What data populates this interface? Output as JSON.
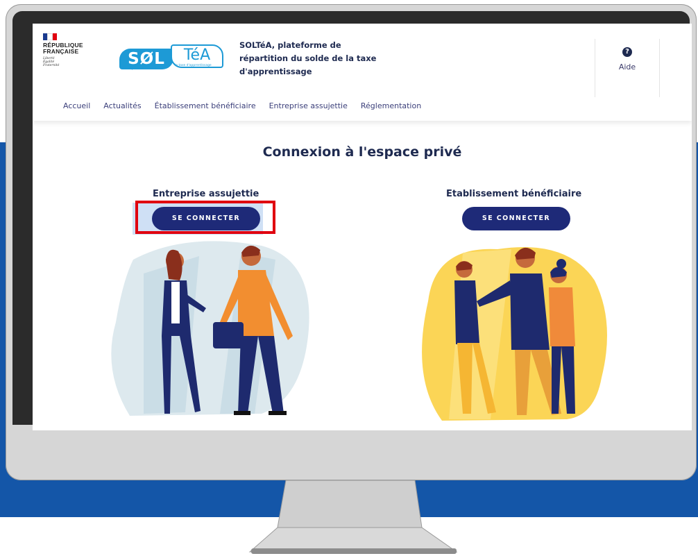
{
  "header": {
    "republic_label": [
      "RÉPUBLIQUE",
      "FRANÇAISE"
    ],
    "devise": [
      "Liberté",
      "Égalité",
      "Fraternité"
    ],
    "logo": {
      "sol": "SØL",
      "tea": "TéA",
      "sub_left": "Répartir le solde de",
      "sub_right": "la taxe d'apprentissage"
    },
    "tagline": "SOLTéA, plateforme de répartition du solde de la taxe d'apprentissage",
    "help_icon": "question-circle-icon",
    "help_label": "Aide"
  },
  "nav": {
    "items": [
      "Accueil",
      "Actualités",
      "Établissement bénéficiaire",
      "Entreprise assujettie",
      "Réglementation"
    ]
  },
  "main": {
    "title": "Connexion à l'espace privé",
    "left": {
      "heading": "Entreprise assujettie",
      "button": "SE CONNECTER"
    },
    "right": {
      "heading": "Etablissement bénéficiaire",
      "button": "SE CONNECTER"
    }
  },
  "colors": {
    "brand_blue": "#1e2a78",
    "accent_blue": "#1d9ad6",
    "highlight_red": "#e0000f",
    "background_blue": "#1456a8"
  }
}
